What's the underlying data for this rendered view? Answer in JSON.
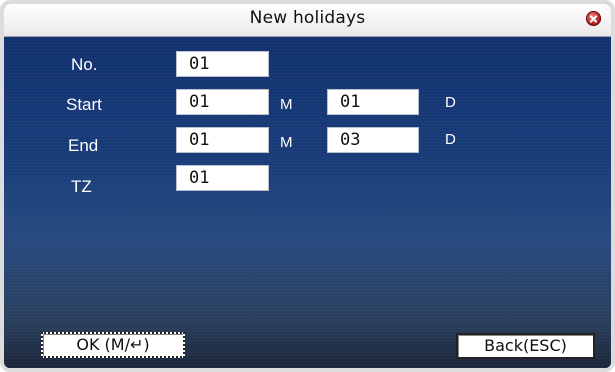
{
  "window": {
    "title": "New holidays",
    "close_icon": "close-icon"
  },
  "form": {
    "no_label": "No.",
    "no_value": "01",
    "start_label": "Start",
    "start_month": "01",
    "start_month_unit": "M",
    "start_day": "01",
    "start_day_unit": "D",
    "end_label": "End",
    "end_month": "01",
    "end_month_unit": "M",
    "end_day": "03",
    "end_day_unit": "D",
    "tz_label": "TZ",
    "tz_value": "01"
  },
  "buttons": {
    "ok_label": "OK (M/↵)",
    "back_label": "Back(ESC)"
  },
  "colors": {
    "background": "#1a3d7a",
    "titlebar": "#f2f2f2",
    "close": "#b11c1c"
  }
}
